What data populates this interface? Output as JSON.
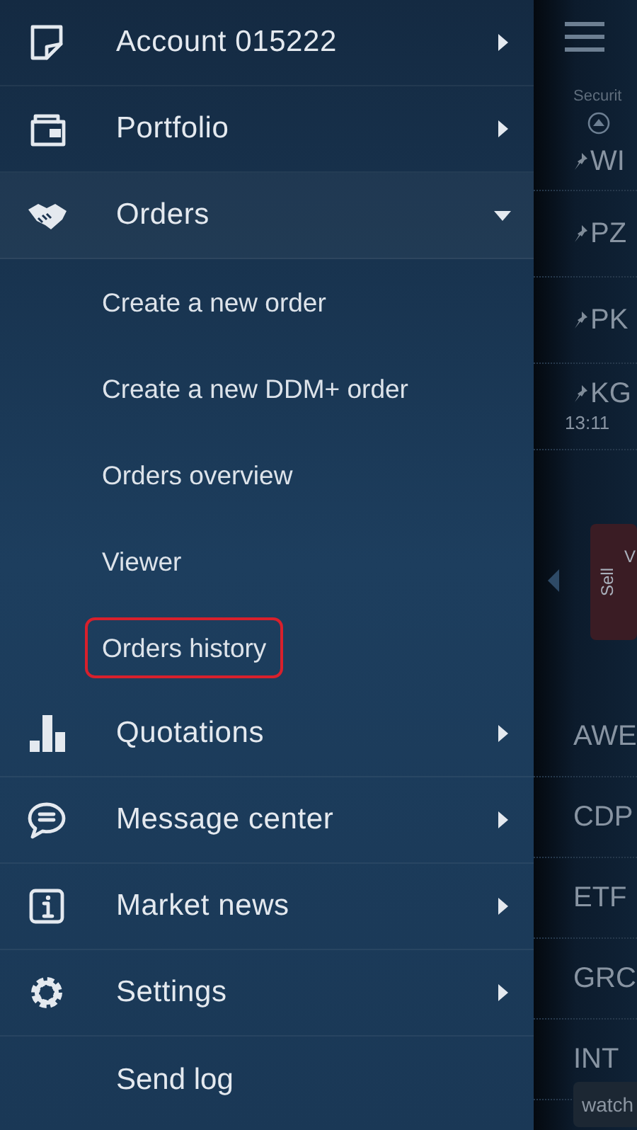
{
  "menu": [
    {
      "kind": "section",
      "label": "Account 015222",
      "expanded": false
    },
    {
      "kind": "section",
      "label": "Portfolio",
      "expanded": false
    },
    {
      "kind": "section",
      "label": "Orders",
      "expanded": true,
      "children": [
        {
          "label": "Create a new order",
          "selected": false
        },
        {
          "label": "Create a new DDM+ order",
          "selected": false
        },
        {
          "label": "Orders overview",
          "selected": false
        },
        {
          "label": "Viewer",
          "selected": false
        },
        {
          "label": "Orders history",
          "selected": true
        }
      ]
    },
    {
      "kind": "section",
      "label": "Quotations",
      "expanded": false
    },
    {
      "kind": "section",
      "label": "Message center",
      "expanded": false
    },
    {
      "kind": "section",
      "label": "Market news",
      "expanded": false
    },
    {
      "kind": "section",
      "label": "Settings",
      "expanded": false
    },
    {
      "kind": "action",
      "label": "Send log"
    }
  ],
  "panel": {
    "header": "Securit",
    "pinned_rows": [
      {
        "symbol": "WI"
      },
      {
        "symbol": "PZ"
      },
      {
        "symbol": "PK"
      },
      {
        "symbol": "KG",
        "time": "13:11"
      }
    ],
    "sell_button": {
      "label": "Sell",
      "detail": "V"
    },
    "rows": [
      "AWE",
      "CDP",
      "ETF",
      "GRC",
      "INT"
    ],
    "footer_button": "watch"
  }
}
